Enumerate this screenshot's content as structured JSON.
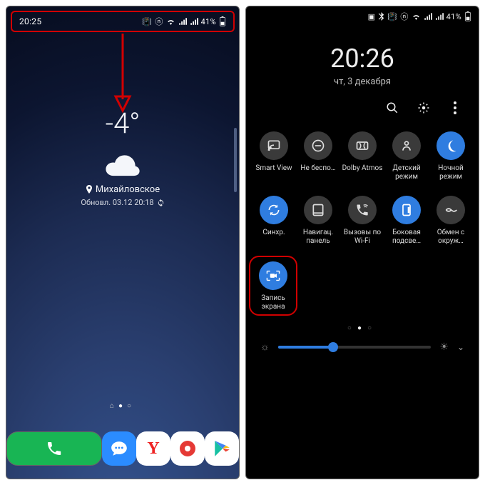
{
  "left": {
    "statusbar": {
      "time": "20:25",
      "battery": "41%"
    },
    "weather": {
      "temp": "-4°",
      "location": "Михайловское",
      "updated": "Обновл. 03.12 20:18"
    }
  },
  "right": {
    "statusbar": {
      "battery": "41%"
    },
    "clock": {
      "time": "20:26",
      "date": "чт, 3 декабря"
    },
    "tiles": [
      {
        "id": "smartview",
        "label": "Smart View",
        "on": false,
        "icon": "cast"
      },
      {
        "id": "dnd",
        "label": "Не беспо…",
        "on": false,
        "icon": "minus"
      },
      {
        "id": "dolby",
        "label": "Dolby Atmos",
        "on": false,
        "icon": "dolby"
      },
      {
        "id": "kids",
        "label": "Детский режим",
        "on": false,
        "icon": "kid"
      },
      {
        "id": "night",
        "label": "Ночной режим",
        "on": true,
        "icon": "moon"
      },
      {
        "id": "sync",
        "label": "Синхр.",
        "on": true,
        "icon": "sync"
      },
      {
        "id": "navbar",
        "label": "Навигац. панель",
        "on": false,
        "icon": "navbar"
      },
      {
        "id": "wificall",
        "label": "Вызовы по Wi-Fi",
        "on": false,
        "icon": "wificall"
      },
      {
        "id": "edge",
        "label": "Боковая подсве…",
        "on": true,
        "icon": "edge"
      },
      {
        "id": "nearby",
        "label": "Обмен с окруж…",
        "on": false,
        "icon": "share"
      }
    ],
    "record_tile": {
      "label": "Запись экрана",
      "on": true
    },
    "brightness": {
      "percent": 36
    }
  }
}
